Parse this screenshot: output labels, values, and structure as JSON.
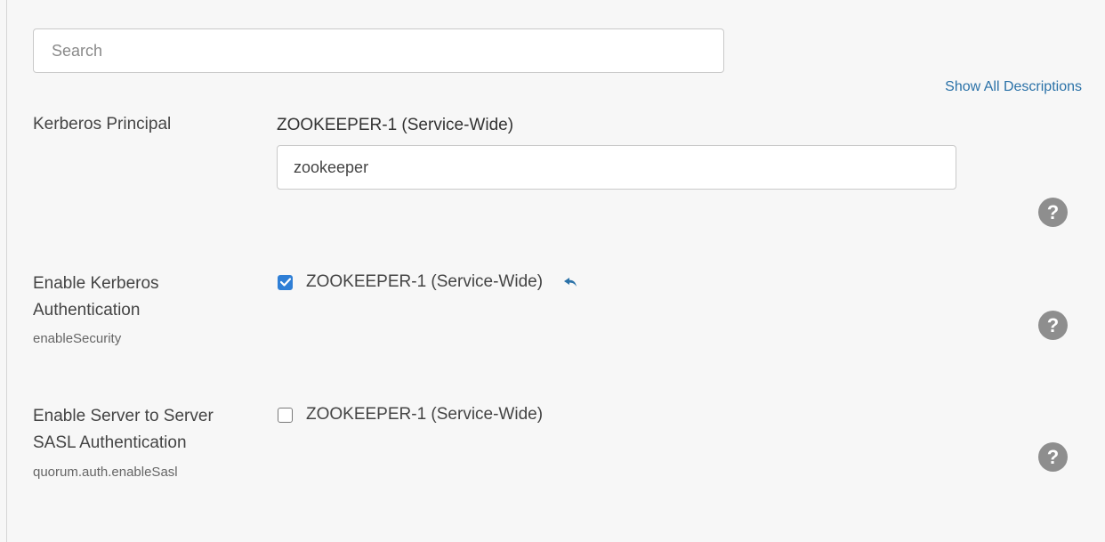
{
  "search": {
    "placeholder": "Search",
    "value": ""
  },
  "show_all_descriptions": "Show All Descriptions",
  "properties": [
    {
      "label": "Kerberos Principal",
      "key": "",
      "scope": "ZOOKEEPER-1 (Service-Wide)",
      "value": "zookeeper",
      "help_icon": "question-circle-icon"
    },
    {
      "label": "Enable Kerberos Authentication",
      "key": "enableSecurity",
      "scope": "ZOOKEEPER-1 (Service-Wide)",
      "checked": true,
      "revert_icon": "undo-arrow-icon",
      "help_icon": "question-circle-icon"
    },
    {
      "label": "Enable Server to Server SASL Authentication",
      "key": "quorum.auth.enableSasl",
      "scope": "ZOOKEEPER-1 (Service-Wide)",
      "checked": false,
      "help_icon": "question-circle-icon"
    }
  ],
  "help_glyph": "?",
  "colors": {
    "background": "#f7f7f7",
    "link": "#2b72a8",
    "checkbox_checked": "#2f7fd6",
    "help_icon": "#8e8e8e"
  }
}
